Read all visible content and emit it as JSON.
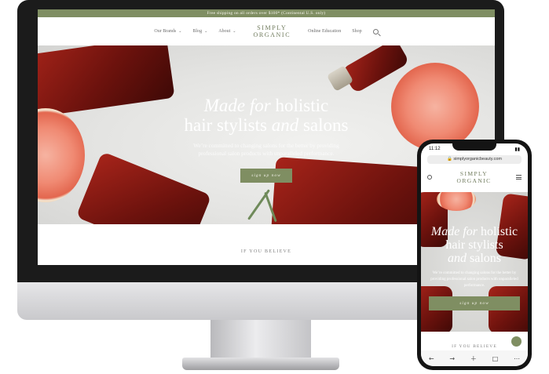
{
  "desktop": {
    "promo_bar": "Free shipping on all orders over $100* (Continental U.S. only)",
    "nav": {
      "items": [
        {
          "label": "Our Brands",
          "has_dropdown": true
        },
        {
          "label": "Blog",
          "has_dropdown": true
        },
        {
          "label": "About",
          "has_dropdown": true
        },
        {
          "label": "Online Education",
          "has_dropdown": false
        },
        {
          "label": "Shop",
          "has_dropdown": false
        }
      ],
      "logo_line1": "SIMPLY",
      "logo_line2": "ORGANIC",
      "search_icon": "search-icon"
    },
    "hero": {
      "title_italic1": "Made for",
      "title_plain1": "holistic",
      "title_plain2": "hair stylists",
      "title_italic2": "and",
      "title_plain3": "salons",
      "subtitle_line1": "We’re committed to changing salons for the better by providing",
      "subtitle_line2": "professional salon products with unparalleled performance.",
      "button": "sign up now"
    },
    "section_heading": "IF YOU BELIEVE"
  },
  "phone": {
    "status_time": "11:12",
    "url": "simplyorganicbeauty.com",
    "logo_line1": "SIMPLY",
    "logo_line2": "ORGANIC",
    "hero": {
      "title_italic1": "Made for",
      "title_plain1": "holistic",
      "title_plain2": "hair stylists",
      "title_italic2": "and",
      "title_plain3": "salons",
      "subtitle": "We’re committed to changing salons for the better by providing professional salon products with unparalleled performance.",
      "button": "sign up now"
    },
    "section_heading": "IF YOU BELIEVE",
    "toolbar_icons": [
      "back-icon",
      "forward-icon",
      "new-tab-icon",
      "tabs-icon",
      "menu-icon"
    ]
  },
  "colors": {
    "accent_green": "#7f8e62",
    "logo_green": "#6f7a5c",
    "bottle_red": "#8e1c13"
  }
}
